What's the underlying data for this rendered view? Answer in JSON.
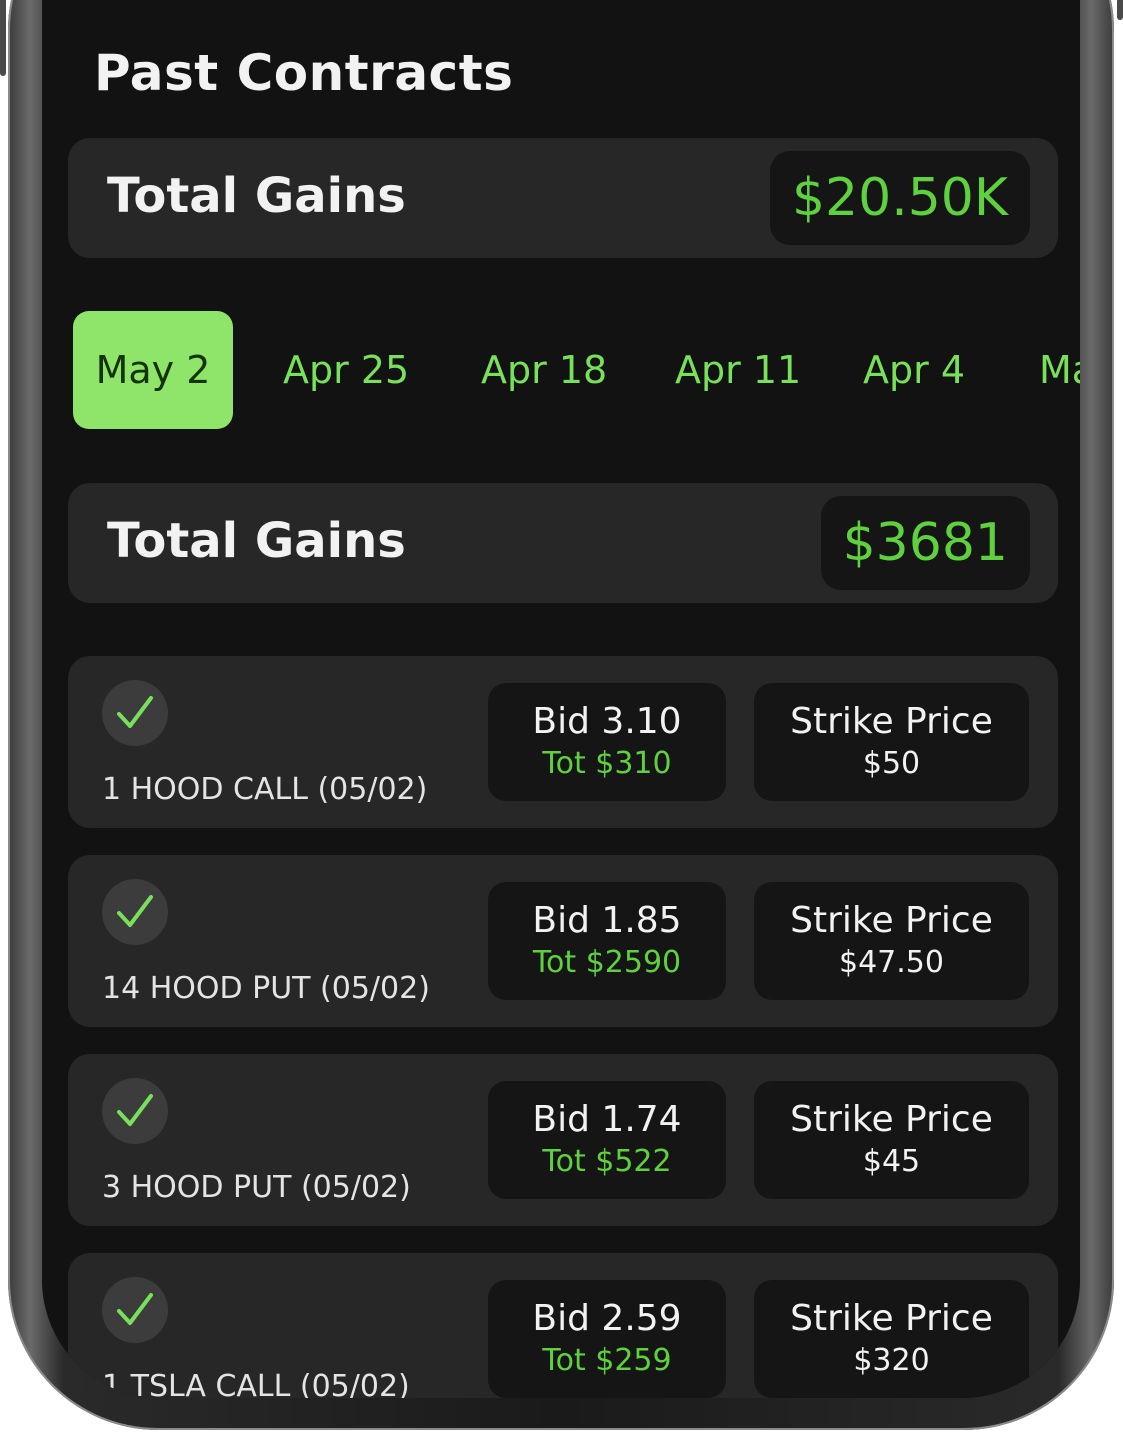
{
  "header": {
    "title": "Past Contracts"
  },
  "overall_gains": {
    "label": "Total Gains",
    "value": "$20.50K"
  },
  "date_tabs": [
    {
      "label": "May 2",
      "active": true
    },
    {
      "label": "Apr 25",
      "active": false
    },
    {
      "label": "Apr 18",
      "active": false
    },
    {
      "label": "Apr 11",
      "active": false
    },
    {
      "label": "Apr 4",
      "active": false
    },
    {
      "label": "Ma",
      "active": false
    }
  ],
  "week_gains": {
    "label": "Total Gains",
    "value": "$3681"
  },
  "contracts": [
    {
      "name": "1 HOOD CALL (05/02)",
      "bid": "Bid 3.10",
      "total": "Tot $310",
      "strike_label": "Strike Price",
      "strike_value": "$50",
      "status_icon": "check-icon"
    },
    {
      "name": "14 HOOD PUT (05/02)",
      "bid": "Bid 1.85",
      "total": "Tot $2590",
      "strike_label": "Strike Price",
      "strike_value": "$47.50",
      "status_icon": "check-icon"
    },
    {
      "name": "3 HOOD PUT (05/02)",
      "bid": "Bid 1.74",
      "total": "Tot $522",
      "strike_label": "Strike Price",
      "strike_value": "$45",
      "status_icon": "check-icon"
    },
    {
      "name": "1 TSLA CALL (05/02)",
      "bid": "Bid 2.59",
      "total": "Tot $259",
      "strike_label": "Strike Price",
      "strike_value": "$320",
      "status_icon": "check-icon"
    }
  ],
  "colors": {
    "background": "#111211",
    "card": "#262726",
    "pill": "#141514",
    "accent_green": "#5fd13f",
    "active_tab": "#8fe46a",
    "tab_text": "#78e05a"
  }
}
